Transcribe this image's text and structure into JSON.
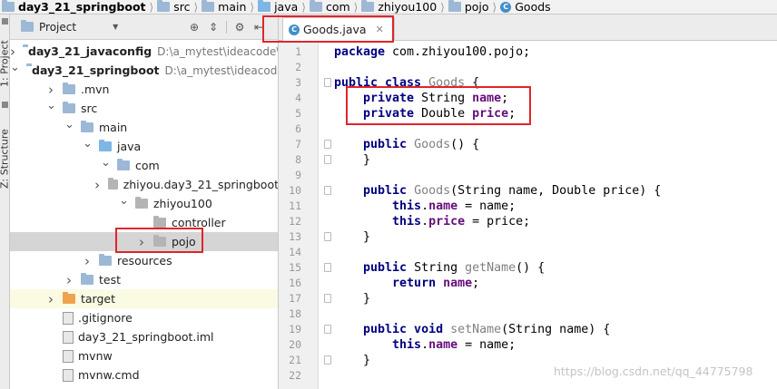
{
  "breadcrumb": [
    {
      "label": "day3_21_springboot",
      "icon": "folder-icon",
      "bold": true
    },
    {
      "label": "src",
      "icon": "folder-icon"
    },
    {
      "label": "main",
      "icon": "folder-icon"
    },
    {
      "label": "java",
      "icon": "source-folder-icon"
    },
    {
      "label": "com",
      "icon": "folder-icon"
    },
    {
      "label": "zhiyou100",
      "icon": "folder-icon"
    },
    {
      "label": "pojo",
      "icon": "folder-icon"
    },
    {
      "label": "Goods",
      "icon": "class-icon"
    }
  ],
  "sidebar_tabs": {
    "project": "1: Project",
    "structure": "Z: Structure"
  },
  "project_panel": {
    "title": "Project",
    "tree": [
      {
        "label": "day3_21_javaconfig",
        "path": "D:\\a_mytest\\ideacode\\",
        "bold": true,
        "arrow": "collapsed",
        "icon": "module-folder-icon",
        "level": 0
      },
      {
        "label": "day3_21_springboot",
        "path": "D:\\a_mytest\\ideacode\\",
        "bold": true,
        "arrow": "expanded",
        "icon": "module-folder-icon",
        "level": 0
      },
      {
        "label": ".mvn",
        "arrow": "collapsed",
        "icon": "folder-icon",
        "level": 1
      },
      {
        "label": "src",
        "arrow": "expanded",
        "icon": "folder-icon",
        "level": 1
      },
      {
        "label": "main",
        "arrow": "expanded",
        "icon": "folder-icon",
        "level": 2
      },
      {
        "label": "java",
        "arrow": "expanded",
        "icon": "source-folder-icon",
        "level": 3
      },
      {
        "label": "com",
        "arrow": "expanded",
        "icon": "folder-icon",
        "level": 4
      },
      {
        "label": "zhiyou.day3_21_springboot",
        "arrow": "collapsed",
        "icon": "package-icon",
        "level": 5
      },
      {
        "label": "zhiyou100",
        "arrow": "expanded",
        "icon": "package-icon",
        "level": 5
      },
      {
        "label": "controller",
        "arrow": "none",
        "icon": "package-icon",
        "level": 6
      },
      {
        "label": "pojo",
        "arrow": "collapsed",
        "icon": "package-icon",
        "level": 6,
        "selected": true
      },
      {
        "label": "resources",
        "arrow": "collapsed",
        "icon": "resources-folder-icon",
        "level": 3
      },
      {
        "label": "test",
        "arrow": "collapsed",
        "icon": "folder-icon",
        "level": 2
      },
      {
        "label": "target",
        "arrow": "collapsed",
        "icon": "excluded-folder-icon",
        "level": 1,
        "highlight": true
      },
      {
        "label": ".gitignore",
        "arrow": "none",
        "icon": "file-icon",
        "level": 1
      },
      {
        "label": "day3_21_springboot.iml",
        "arrow": "none",
        "icon": "file-icon",
        "level": 1
      },
      {
        "label": "mvnw",
        "arrow": "none",
        "icon": "file-icon",
        "level": 1
      },
      {
        "label": "mvnw.cmd",
        "arrow": "none",
        "icon": "file-icon",
        "level": 1
      }
    ]
  },
  "editor": {
    "tab_label": "Goods.java",
    "line_numbers": [
      "1",
      "2",
      "3",
      "4",
      "5",
      "6",
      "7",
      "8",
      "9",
      "10",
      "11",
      "12",
      "13",
      "14",
      "15",
      "16",
      "17",
      "18",
      "19",
      "20",
      "21",
      "22"
    ],
    "lines": [
      {
        "num": 1,
        "tokens": [
          {
            "t": "package ",
            "c": "kw"
          },
          {
            "t": "com.zhiyou100.pojo;",
            "c": ""
          }
        ]
      },
      {
        "num": 2,
        "tokens": []
      },
      {
        "num": 3,
        "tokens": [
          {
            "t": "public class ",
            "c": "kw"
          },
          {
            "t": "Goods",
            "c": "unused"
          },
          {
            "t": " {",
            "c": ""
          }
        ]
      },
      {
        "num": 4,
        "tokens": [
          {
            "t": "    private ",
            "c": "kw"
          },
          {
            "t": "String ",
            "c": ""
          },
          {
            "t": "name",
            "c": "fld"
          },
          {
            "t": ";",
            "c": ""
          }
        ]
      },
      {
        "num": 5,
        "tokens": [
          {
            "t": "    private ",
            "c": "kw"
          },
          {
            "t": "Double ",
            "c": ""
          },
          {
            "t": "price",
            "c": "fld"
          },
          {
            "t": ";",
            "c": ""
          }
        ]
      },
      {
        "num": 6,
        "tokens": []
      },
      {
        "num": 7,
        "tokens": [
          {
            "t": "    public ",
            "c": "kw"
          },
          {
            "t": "Goods",
            "c": "unused"
          },
          {
            "t": "() {",
            "c": ""
          }
        ]
      },
      {
        "num": 8,
        "tokens": [
          {
            "t": "    }",
            "c": ""
          }
        ]
      },
      {
        "num": 9,
        "tokens": []
      },
      {
        "num": 10,
        "tokens": [
          {
            "t": "    public ",
            "c": "kw"
          },
          {
            "t": "Goods",
            "c": "unused"
          },
          {
            "t": "(String name, Double price) {",
            "c": ""
          }
        ]
      },
      {
        "num": 11,
        "tokens": [
          {
            "t": "        this",
            "c": "kw"
          },
          {
            "t": ".",
            "c": ""
          },
          {
            "t": "name",
            "c": "fld"
          },
          {
            "t": " = name;",
            "c": ""
          }
        ]
      },
      {
        "num": 12,
        "tokens": [
          {
            "t": "        this",
            "c": "kw"
          },
          {
            "t": ".",
            "c": ""
          },
          {
            "t": "price",
            "c": "fld"
          },
          {
            "t": " = price;",
            "c": ""
          }
        ]
      },
      {
        "num": 13,
        "tokens": [
          {
            "t": "    }",
            "c": ""
          }
        ]
      },
      {
        "num": 14,
        "tokens": []
      },
      {
        "num": 15,
        "tokens": [
          {
            "t": "    public ",
            "c": "kw"
          },
          {
            "t": "String ",
            "c": ""
          },
          {
            "t": "getName",
            "c": "unused"
          },
          {
            "t": "() {",
            "c": ""
          }
        ]
      },
      {
        "num": 16,
        "tokens": [
          {
            "t": "        return ",
            "c": "kw"
          },
          {
            "t": "name",
            "c": "fld"
          },
          {
            "t": ";",
            "c": ""
          }
        ]
      },
      {
        "num": 17,
        "tokens": [
          {
            "t": "    }",
            "c": ""
          }
        ]
      },
      {
        "num": 18,
        "tokens": []
      },
      {
        "num": 19,
        "tokens": [
          {
            "t": "    public void ",
            "c": "kw"
          },
          {
            "t": "setName",
            "c": "unused"
          },
          {
            "t": "(String name) {",
            "c": ""
          }
        ]
      },
      {
        "num": 20,
        "tokens": [
          {
            "t": "        this",
            "c": "kw"
          },
          {
            "t": ".",
            "c": ""
          },
          {
            "t": "name",
            "c": "fld"
          },
          {
            "t": " = name;",
            "c": ""
          }
        ]
      },
      {
        "num": 21,
        "tokens": [
          {
            "t": "    }",
            "c": ""
          }
        ]
      },
      {
        "num": 22,
        "tokens": []
      }
    ]
  },
  "watermark": "https://blog.csdn.net/qq_44775798",
  "colors": {
    "keyword": "#000080",
    "field": "#660e7a",
    "unused": "#808080",
    "annotation_box": "#e0252a",
    "selection": "#d5d5d5"
  }
}
